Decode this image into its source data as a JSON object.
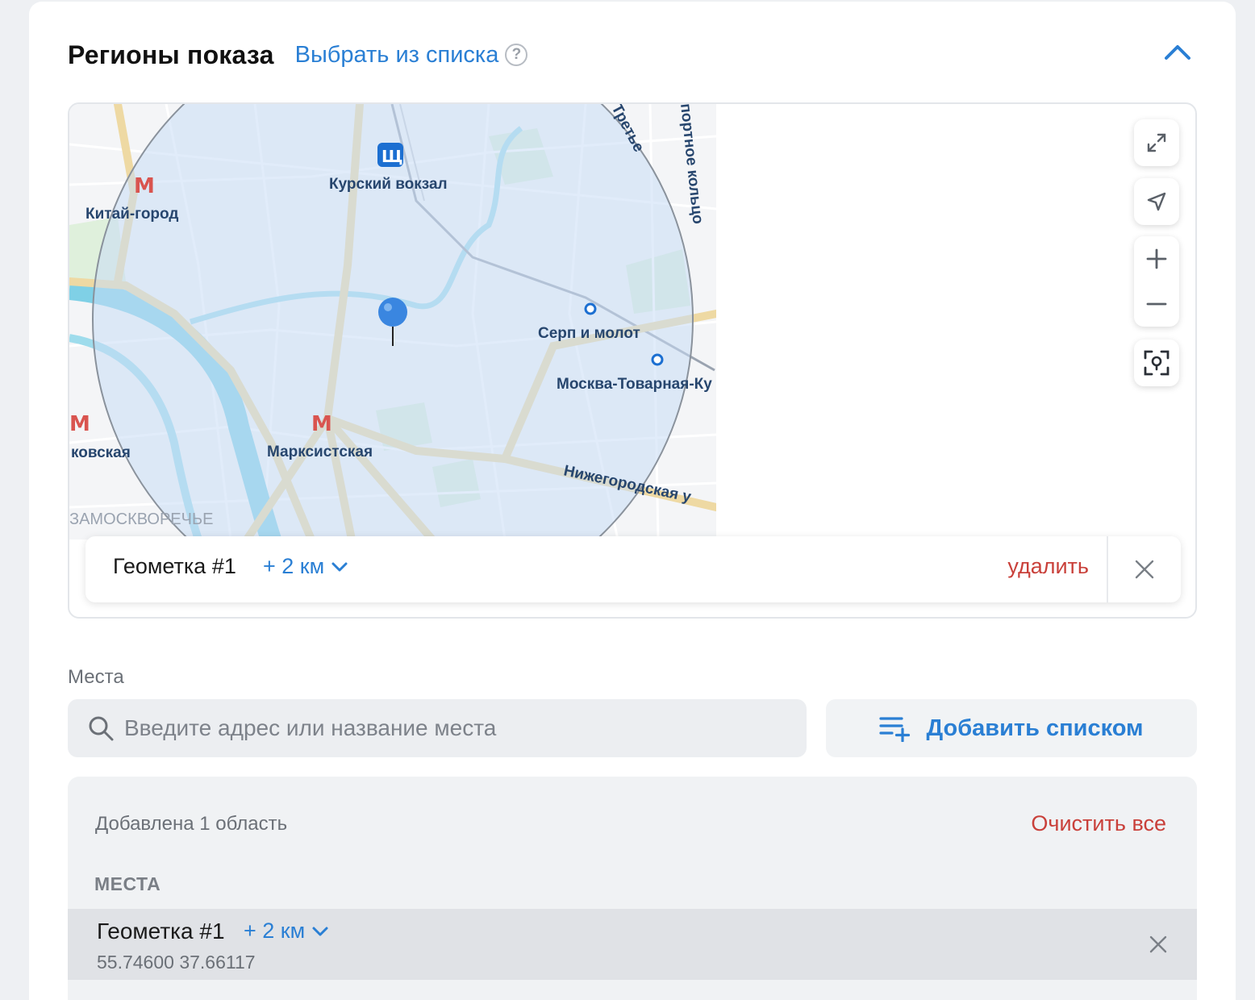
{
  "header": {
    "title": "Регионы показа",
    "choose_link": "Выбрать из списка",
    "help_icon": "question-circle-icon",
    "collapse_icon": "chevron-up-icon"
  },
  "map": {
    "labels": {
      "kitay_gorod": "Китай-город",
      "kursky": "Курский вокзал",
      "serp": "Серп и молот",
      "moskva_tov": "Москва-Товарная-Ку",
      "marksistskaya": "Марксистская",
      "kovskaya": "ковская",
      "nizhegorodskaya": "Нижегородская у",
      "zamoskvorechye": "ЗАМОСКВОРЕЧЬЕ",
      "tretye": "Третье",
      "transport_ring": "портное кольцо"
    },
    "controls": [
      "expand-icon",
      "locate-arrow-icon",
      "zoom-in-icon",
      "zoom-out-icon",
      "focus-pin-icon"
    ]
  },
  "geo_bar": {
    "name": "Геометка #1",
    "radius": "+ 2 км",
    "delete": "удалить"
  },
  "places": {
    "label": "Места",
    "search_placeholder": "Введите адрес или название места",
    "add_list": "Добавить списком"
  },
  "summary": {
    "count": "Добавлена 1 область",
    "clear_all": "Очистить все",
    "section": "МЕСТА",
    "item": {
      "name": "Геометка #1",
      "radius": "+ 2 км",
      "coords": "55.74600 37.66117"
    }
  },
  "colors": {
    "accent": "#2a7fd4",
    "danger": "#c9403a",
    "river": "#7fd0e6",
    "road": "#eed9a3"
  }
}
